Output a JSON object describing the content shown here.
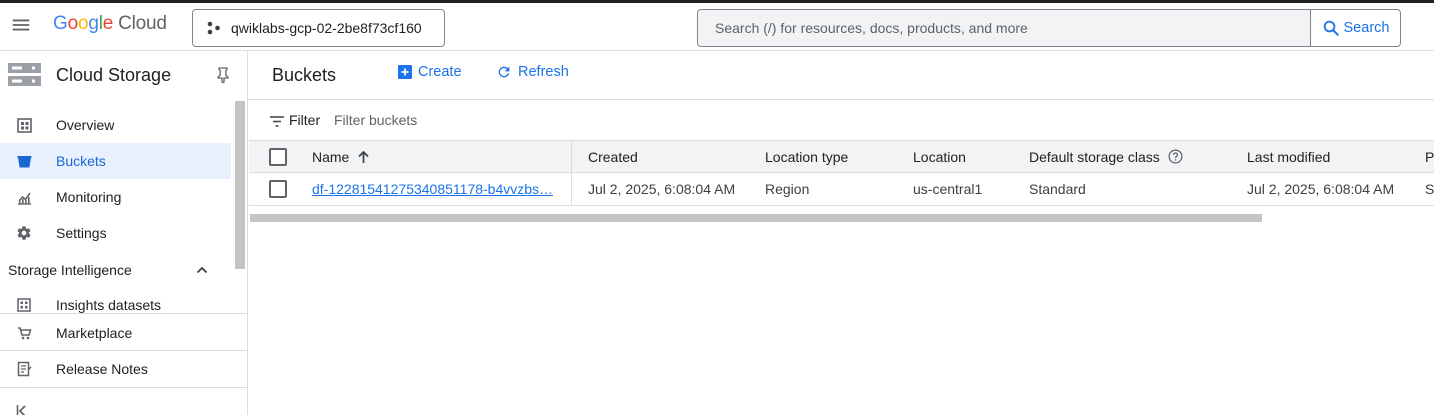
{
  "header": {
    "logo": {
      "google": "Google",
      "cloud": "Cloud"
    },
    "project_name": "qwiklabs-gcp-02-2be8f73cf160",
    "search_placeholder": "Search (/) for resources, docs, products, and more",
    "search_button": "Search"
  },
  "sidebar": {
    "product_title": "Cloud Storage",
    "items": [
      {
        "label": "Overview",
        "icon": "overview-icon",
        "active": false
      },
      {
        "label": "Buckets",
        "icon": "bucket-icon",
        "active": true
      },
      {
        "label": "Monitoring",
        "icon": "monitoring-icon",
        "active": false
      },
      {
        "label": "Settings",
        "icon": "gear-icon",
        "active": false
      }
    ],
    "section": {
      "label": "Storage Intelligence",
      "expanded": true
    },
    "section_items": [
      {
        "label": "Insights datasets",
        "icon": "insights-icon"
      }
    ],
    "footer_items": [
      {
        "label": "Marketplace",
        "icon": "marketplace-icon"
      },
      {
        "label": "Release Notes",
        "icon": "release-notes-icon"
      }
    ]
  },
  "main": {
    "page_title": "Buckets",
    "actions": {
      "create": "Create",
      "refresh": "Refresh"
    },
    "filter": {
      "label": "Filter",
      "placeholder": "Filter buckets"
    },
    "table": {
      "columns": [
        "Name",
        "Created",
        "Location type",
        "Location",
        "Default storage class",
        "Last modified",
        "P"
      ],
      "sort": {
        "column": "Name",
        "direction": "ascending"
      },
      "rows": [
        {
          "name": "df-1228154127534085117​8-b4vvzbs…",
          "created": "Jul 2, 2025, 6:08:04 AM",
          "location_type": "Region",
          "location": "us-central1",
          "storage_class": "Standard",
          "last_modified": "Jul 2, 2025, 6:08:04 AM",
          "extra": "S"
        }
      ]
    }
  },
  "colors": {
    "accent": "#1a73e8",
    "active_bg": "#e8f0fe",
    "border": "#dadce0",
    "header_bg": "#f1f3f4"
  }
}
